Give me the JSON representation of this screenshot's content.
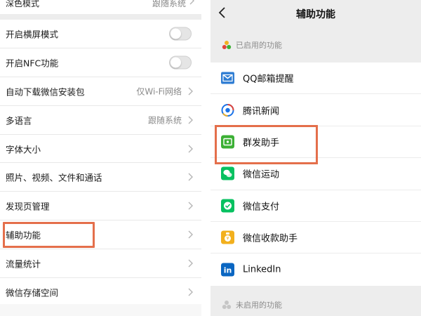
{
  "left": {
    "top_row": {
      "label": "深色模式",
      "value": "跟随系统"
    },
    "rows": [
      {
        "label": "开启横屏模式",
        "type": "toggle",
        "on": false
      },
      {
        "label": "开启NFC功能",
        "type": "toggle",
        "on": false
      },
      {
        "label": "自动下载微信安装包",
        "type": "link",
        "value": "仅Wi-Fi网络"
      },
      {
        "label": "多语言",
        "type": "link",
        "value": "跟随系统"
      },
      {
        "label": "字体大小",
        "type": "link",
        "value": ""
      },
      {
        "label": "照片、视频、文件和通话",
        "type": "link",
        "value": ""
      },
      {
        "label": "发现页管理",
        "type": "link",
        "value": ""
      },
      {
        "label": "辅助功能",
        "type": "link",
        "value": ""
      },
      {
        "label": "流量统计",
        "type": "link",
        "value": ""
      },
      {
        "label": "微信存储空间",
        "type": "link",
        "value": ""
      }
    ]
  },
  "right": {
    "title": "辅助功能",
    "enabled_section": "已启用的功能",
    "disabled_section": "未启用的功能",
    "items": [
      {
        "name": "QQ邮箱提醒",
        "icon": "mail-icon",
        "color": "#2f7dd3"
      },
      {
        "name": "腾讯新闻",
        "icon": "news-icon",
        "color": "#1a73e8"
      },
      {
        "name": "群发助手",
        "icon": "broadcast-icon",
        "color": "#3cb035"
      },
      {
        "name": "微信运动",
        "icon": "sport-icon",
        "color": "#07c160"
      },
      {
        "name": "微信支付",
        "icon": "pay-icon",
        "color": "#07c160"
      },
      {
        "name": "微信收款助手",
        "icon": "receipt-icon",
        "color": "#f2b01e"
      },
      {
        "name": "LinkedIn",
        "icon": "linkedin-icon",
        "color": "#0a66c2"
      }
    ]
  },
  "colors": {
    "highlight": "#e46f4b",
    "background": "#ededed"
  }
}
